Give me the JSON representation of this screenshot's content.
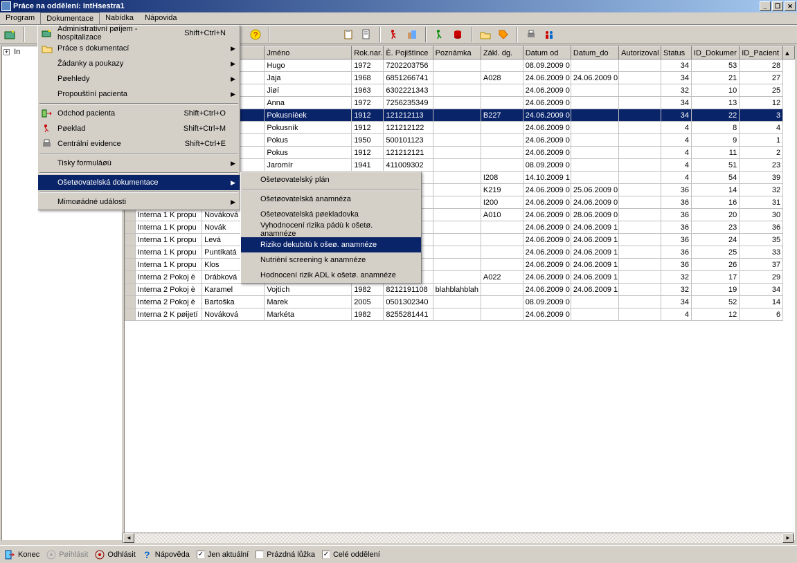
{
  "title": "Práce na oddělení: IntHsestra1",
  "menu": {
    "program": "Program",
    "dokumentace": "Dokumentace",
    "nabidka": "Nabídka",
    "napoveda": "Nápovida"
  },
  "dropdown1": {
    "admin": "Administrativní pøíjem - hospitalizace",
    "admin_sc": "Shift+Ctrl+N",
    "prace": "Práce s dokumentací",
    "zadanky": "Žádanky a poukazy",
    "prehledy": "Pøehledy",
    "propousteni": "Propouštìní pacienta",
    "odchod": "Odchod pacienta",
    "odchod_sc": "Shift+Ctrl+O",
    "preklad": "Pøeklad",
    "preklad_sc": "Shift+Ctrl+M",
    "centralni": "Centrální evidence",
    "centralni_sc": "Shift+Ctrl+E",
    "tisky": "Tisky formuláøù",
    "osetrovatelska": "Ošetøovatelská dokumentace",
    "mimoradne": "Mimoøádné události"
  },
  "dropdown2": {
    "plan": "Ošetøovatelský plán",
    "anamneza": "Ošetøovatelská anamnéza",
    "prekladovka": "Ošetøovatelská pøekladovka",
    "vyhodnoceni": "Vyhodnocení rizika pádù k ošetø. anamnéze",
    "riziko": "Riziko dekubitù k ošeø. anamnéze",
    "nutricni": "Nutrièní screening k anamnéze",
    "hodnoceni": "Hodnocení rizik ADL k ošetø. anamnéze"
  },
  "columns": {
    "c0": "",
    "c1": "",
    "c2": "",
    "c3": "Jméno",
    "c4": "Rok.nar.",
    "c5": "È. Pojištìnce",
    "c6": "Poznámka",
    "c7": "Zákl. dg.",
    "c8": "Datum od",
    "c9": "Datum_do",
    "c10": "Autorizoval",
    "c11": "Status",
    "c12": "ID_Dokumer",
    "c13": "ID_Pacient"
  },
  "rows": [
    {
      "loc": "",
      "pac": "",
      "jm": "Hugo",
      "rok": "1972",
      "cp": "7202203756",
      "poz": "",
      "dg": "",
      "od": "08.09.2009 0",
      "do": "",
      "aut": "",
      "st": "34",
      "idd": "53",
      "idp": "28"
    },
    {
      "loc": "",
      "pac": "",
      "jm": "Jaja",
      "rok": "1968",
      "cp": "6851266741",
      "poz": "",
      "dg": "A028",
      "od": "24.06.2009 0",
      "do": "24.06.2009 0",
      "aut": "",
      "st": "34",
      "idd": "21",
      "idp": "27"
    },
    {
      "loc": "",
      "pac": "",
      "jm": "Jiøí",
      "rok": "1963",
      "cp": "6302221343",
      "poz": "",
      "dg": "",
      "od": "24.06.2009 0",
      "do": "",
      "aut": "",
      "st": "32",
      "idd": "10",
      "idp": "25"
    },
    {
      "loc": "",
      "pac": "",
      "jm": "Anna",
      "rok": "1972",
      "cp": "7256235349",
      "poz": "",
      "dg": "",
      "od": "24.06.2009 0",
      "do": "",
      "aut": "",
      "st": "34",
      "idd": "13",
      "idp": "12"
    },
    {
      "sel": true,
      "loc": "",
      "pac": "",
      "jm": "Pokusníèek",
      "rok": "1912",
      "cp": "121212113",
      "poz": "",
      "dg": "B227",
      "od": "24.06.2009 0",
      "do": "",
      "aut": "",
      "st": "34",
      "idd": "22",
      "idp": "3"
    },
    {
      "loc": "",
      "pac": "",
      "jm": "Pokusník",
      "rok": "1912",
      "cp": "121212122",
      "poz": "",
      "dg": "",
      "od": "24.06.2009 0",
      "do": "",
      "aut": "",
      "st": "4",
      "idd": "8",
      "idp": "4"
    },
    {
      "loc": "",
      "pac": "",
      "jm": "Pokus",
      "rok": "1950",
      "cp": "500101123",
      "poz": "",
      "dg": "",
      "od": "24.06.2009 0",
      "do": "",
      "aut": "",
      "st": "4",
      "idd": "9",
      "idp": "1"
    },
    {
      "loc": "",
      "pac": "",
      "jm": "Pokus",
      "rok": "1912",
      "cp": "121212121",
      "poz": "",
      "dg": "",
      "od": "24.06.2009 0",
      "do": "",
      "aut": "",
      "st": "4",
      "idd": "11",
      "idp": "2"
    },
    {
      "loc": "",
      "pac": "",
      "jm": "Jaromír",
      "rok": "1941",
      "cp": "411009302",
      "poz": "",
      "dg": "",
      "od": "08.09.2009 0",
      "do": "",
      "aut": "",
      "st": "4",
      "idd": "51",
      "idp": "23"
    },
    {
      "loc": "",
      "pac": "",
      "jm": "",
      "rok": "",
      "cp": "",
      "poz": "",
      "dg": "I208",
      "od": "14.10.2009 1",
      "do": "",
      "aut": "",
      "st": "4",
      "idd": "54",
      "idp": "39"
    },
    {
      "loc": "",
      "pac": "",
      "jm": "",
      "rok": "",
      "cp": "",
      "poz": "",
      "dg": "K219",
      "od": "24.06.2009 0",
      "do": "25.06.2009 0",
      "aut": "",
      "st": "36",
      "idd": "14",
      "idp": "32"
    },
    {
      "loc": "",
      "pac": "",
      "jm": "",
      "rok": "",
      "cp": "",
      "poz": "",
      "dg": "I200",
      "od": "24.06.2009 0",
      "do": "24.06.2009 0",
      "aut": "",
      "st": "36",
      "idd": "16",
      "idp": "31"
    },
    {
      "loc": "Interna 1 K propu",
      "pac": "Nováková",
      "jm": "",
      "rok": "",
      "cp": "",
      "poz": "",
      "dg": "A010",
      "od": "24.06.2009 0",
      "do": "28.06.2009 0",
      "aut": "",
      "st": "36",
      "idd": "20",
      "idp": "30"
    },
    {
      "loc": "Interna 1 K propu",
      "pac": "Novák",
      "jm": "",
      "rok": "",
      "cp": "",
      "poz": "",
      "dg": "",
      "od": "24.06.2009 0",
      "do": "24.06.2009 1",
      "aut": "",
      "st": "36",
      "idd": "23",
      "idp": "36"
    },
    {
      "loc": "Interna 1 K propu",
      "pac": "Levá",
      "jm": "",
      "rok": "",
      "cp": "",
      "poz": "",
      "dg": "",
      "od": "24.06.2009 0",
      "do": "24.06.2009 1",
      "aut": "",
      "st": "36",
      "idd": "24",
      "idp": "35"
    },
    {
      "loc": "Interna 1 K propu",
      "pac": "Puntíkatá",
      "jm": "",
      "rok": "",
      "cp": "",
      "poz": "",
      "dg": "",
      "od": "24.06.2009 0",
      "do": "24.06.2009 1",
      "aut": "",
      "st": "36",
      "idd": "25",
      "idp": "33"
    },
    {
      "loc": "Interna 1 K propu",
      "pac": "Klos",
      "jm": "",
      "rok": "",
      "cp": "",
      "poz": "",
      "dg": "",
      "od": "24.06.2009 0",
      "do": "24.06.2009 1",
      "aut": "",
      "st": "36",
      "idd": "26",
      "idp": "37"
    },
    {
      "loc": "Interna 2 Pokoj è",
      "pac": "Drábková",
      "jm": "",
      "rok": "",
      "cp": "",
      "poz": "",
      "dg": "A022",
      "od": "24.06.2009 0",
      "do": "24.06.2009 1",
      "aut": "",
      "st": "32",
      "idd": "17",
      "idp": "29"
    },
    {
      "loc": "Interna 2 Pokoj è",
      "pac": "Karamel",
      "jm": "Vojtìch",
      "rok": "1982",
      "cp": "8212191108",
      "poz": "blahblahblah",
      "dg": "",
      "od": "24.06.2009 0",
      "do": "24.06.2009 1",
      "aut": "",
      "st": "32",
      "idd": "19",
      "idp": "34"
    },
    {
      "loc": "Interna 2 Pokoj è",
      "pac": "Bartoška",
      "jm": "Marek",
      "rok": "2005",
      "cp": "0501302340",
      "poz": "",
      "dg": "",
      "od": "08.09.2009 0",
      "do": "",
      "aut": "",
      "st": "34",
      "idd": "52",
      "idp": "14"
    },
    {
      "loc": "Interna 2 K pøijetí",
      "pac": "Nováková",
      "jm": "Markéta",
      "rok": "1982",
      "cp": "8255281441",
      "poz": "",
      "dg": "",
      "od": "24.06.2009 0",
      "do": "",
      "aut": "",
      "st": "4",
      "idd": "12",
      "idp": "6"
    }
  ],
  "status": {
    "konec": "Konec",
    "prihlasit": "Pøihlásit",
    "odhlasit": "Odhlásit",
    "napoveda": "Nápověda",
    "jen": "Jen aktuální",
    "prazdna": "Prázdná lůžka",
    "cele": "Celé oddělení"
  },
  "tree": {
    "root": "In"
  }
}
